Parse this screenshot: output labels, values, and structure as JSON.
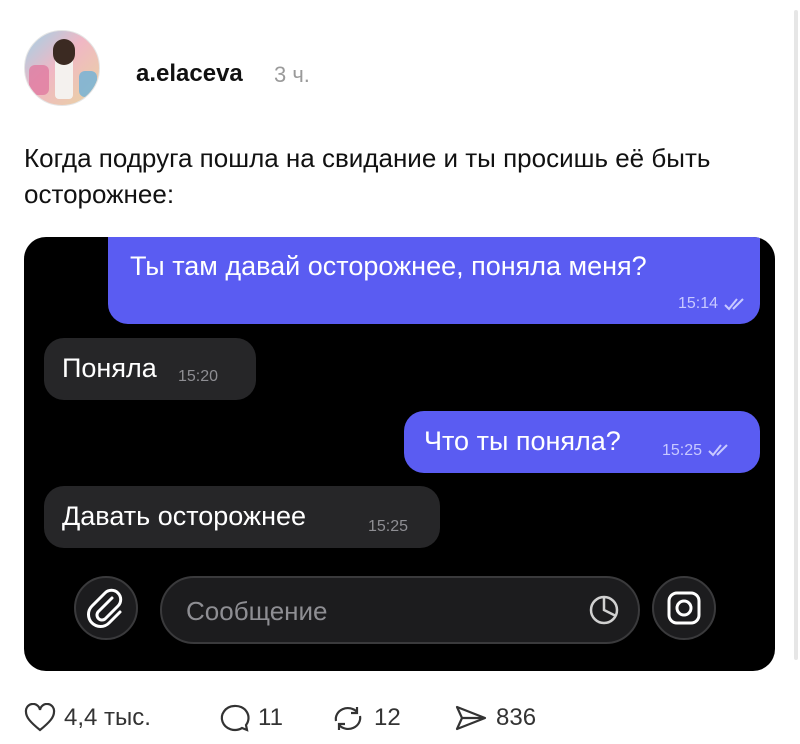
{
  "post": {
    "username": "a.elaceva",
    "time_ago": "3 ч.",
    "caption": "Когда подруга пошла на свидание и ты просишь её быть осторожнее:"
  },
  "chat": {
    "messages": [
      {
        "direction": "outgoing",
        "text": "Ты там давай осторожнее, поняла меня?",
        "time": "15:14",
        "status": "read"
      },
      {
        "direction": "incoming",
        "text": "Поняла",
        "time": "15:20"
      },
      {
        "direction": "outgoing",
        "text": "Что ты поняла?",
        "time": "15:25",
        "status": "read"
      },
      {
        "direction": "incoming",
        "text": "Давать осторожнее",
        "time": "15:25"
      }
    ],
    "input_placeholder": "Сообщение",
    "colors": {
      "outgoing_bubble": "#5a5cf2",
      "incoming_bubble": "#262628",
      "background": "#000000"
    }
  },
  "actions": {
    "likes": "4,4 тыс.",
    "comments": "11",
    "reposts": "12",
    "shares": "836"
  },
  "icons": [
    "avatar",
    "double-check-icon",
    "paperclip-icon",
    "sticker-icon",
    "camera-icon",
    "heart-icon",
    "comment-icon",
    "repost-icon",
    "share-icon"
  ]
}
